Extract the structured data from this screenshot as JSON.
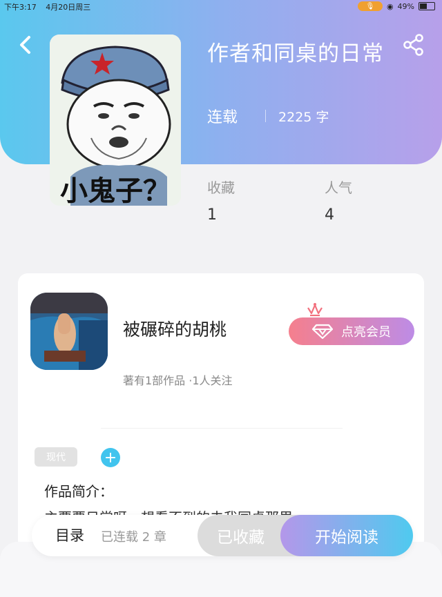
{
  "status_bar": {
    "time": "下午3:17",
    "date": "4月20日周三",
    "battery": "49%",
    "battery_level": 0.49
  },
  "book": {
    "title": "作者和同桌的日常",
    "status": "连载",
    "word_count": "2225 字",
    "cover_caption": "小鬼子？"
  },
  "stats": [
    {
      "label": "收藏",
      "value": "1"
    },
    {
      "label": "人气",
      "value": "4"
    }
  ],
  "author": {
    "name": "被碾碎的胡桃",
    "meta": "著有1部作品 ·1人关注",
    "vip_label": "点亮会员"
  },
  "tags": [
    {
      "label": "现代"
    }
  ],
  "intro": {
    "label": "作品简介：",
    "text": "主要要日常呀，想看不到的去我同桌那里"
  },
  "toolbar": {
    "toc_label": "目录",
    "chapters": "已连载 2 章",
    "collected_label": "已收藏",
    "read_label": "开始阅读"
  },
  "colors": {
    "accent_blue": "#41c4ee",
    "accent_purple": "#b497ea",
    "vip_pink": "#f57f8d"
  }
}
